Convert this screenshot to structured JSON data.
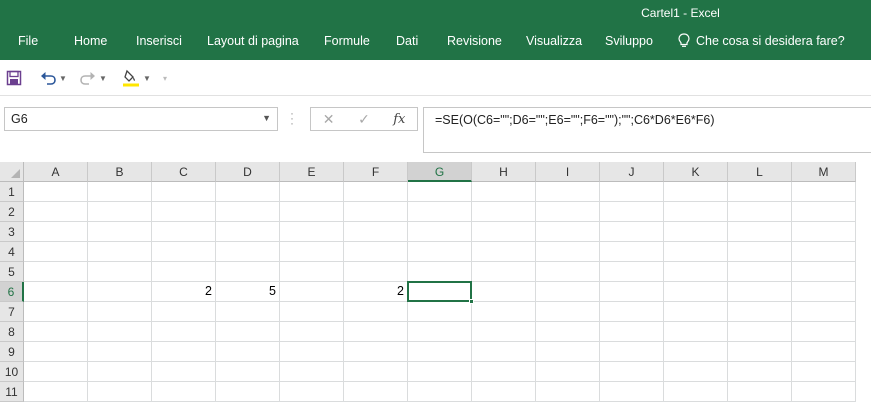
{
  "window": {
    "title": "Cartel1 - Excel"
  },
  "ribbon": {
    "file_label": "File",
    "tabs": [
      "Home",
      "Inserisci",
      "Layout di pagina",
      "Formule",
      "Dati",
      "Revisione",
      "Visualizza",
      "Sviluppo"
    ],
    "tell_me": "Che cosa si desidera fare?"
  },
  "qat": {
    "items": [
      "save-icon",
      "undo-icon",
      "redo-icon",
      "highlight-icon"
    ]
  },
  "formula_bar": {
    "name_box": "G6",
    "formula": "=SE(O(C6=\"\";D6=\"\";E6=\"\";F6=\"\");\"\";C6*D6*E6*F6)",
    "fx_label": "fx"
  },
  "sheet": {
    "columns": [
      "A",
      "B",
      "C",
      "D",
      "E",
      "F",
      "G",
      "H",
      "I",
      "J",
      "K",
      "L",
      "M"
    ],
    "rows": [
      "1",
      "2",
      "3",
      "4",
      "5",
      "6",
      "7",
      "8",
      "9",
      "10",
      "11"
    ],
    "selected_cell": "G6",
    "cells": [
      {
        "ref": "C6",
        "value": "2"
      },
      {
        "ref": "D6",
        "value": "5"
      },
      {
        "ref": "F6",
        "value": "2"
      }
    ]
  },
  "colors": {
    "accent": "#217346",
    "gridline": "#dadcdd",
    "header_bg": "#e6e6e6"
  }
}
